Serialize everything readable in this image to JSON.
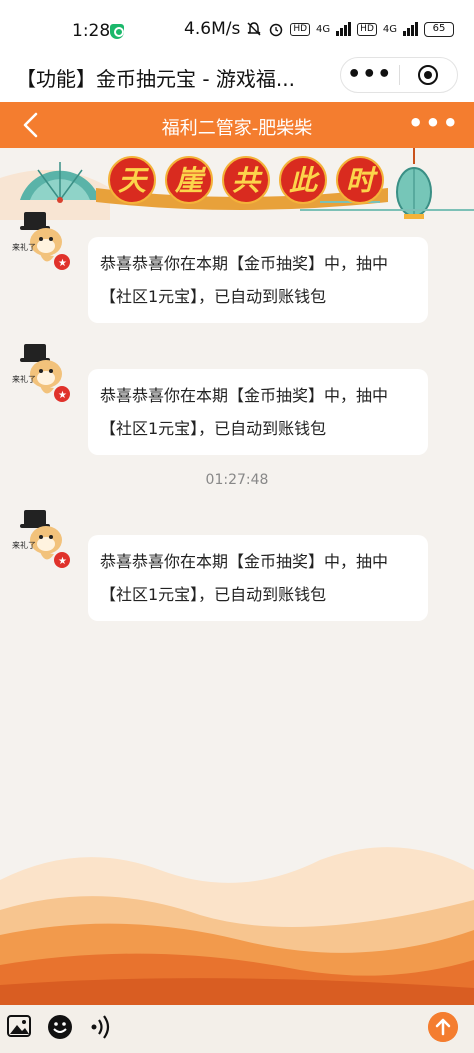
{
  "status_bar": {
    "time": "1:28",
    "speed": "4.6M/s",
    "battery": "65",
    "net1": "4G",
    "net2": "4G",
    "hd1": "HD",
    "hd2": "HD"
  },
  "title_bar": {
    "title": "【功能】金币抽元宝 - 游戏福...",
    "more_label": "•••"
  },
  "chat_header": {
    "title": "福利二管家-肥柴柴",
    "back_icon": "chevron-left-icon",
    "more_icon": "more-dots-icon"
  },
  "banner": {
    "characters": [
      "天",
      "崖",
      "共",
      "此",
      "时"
    ],
    "colors": {
      "badge": "#d92b1f",
      "text": "#fcd54b"
    }
  },
  "messages": [
    {
      "text": "恭喜恭喜你在本期【金币抽奖】中，抽中【社区1元宝】，已自动到账钱包",
      "avatar_caption": "来礼了"
    },
    {
      "text": "恭喜恭喜你在本期【金币抽奖】中，抽中【社区1元宝】，已自动到账钱包",
      "avatar_caption": "来礼了"
    },
    {
      "text": "恭喜恭喜你在本期【金币抽奖】中，抽中【社区1元宝】，已自动到账钱包",
      "avatar_caption": "来礼了"
    }
  ],
  "timestamp": "01:27:48",
  "input_bar": {
    "placeholder": "",
    "icons": [
      "image-icon",
      "emoji-icon",
      "voice-icon",
      "send-icon"
    ]
  },
  "colors": {
    "accent": "#f47d2f",
    "background": "#f5f2ee"
  }
}
